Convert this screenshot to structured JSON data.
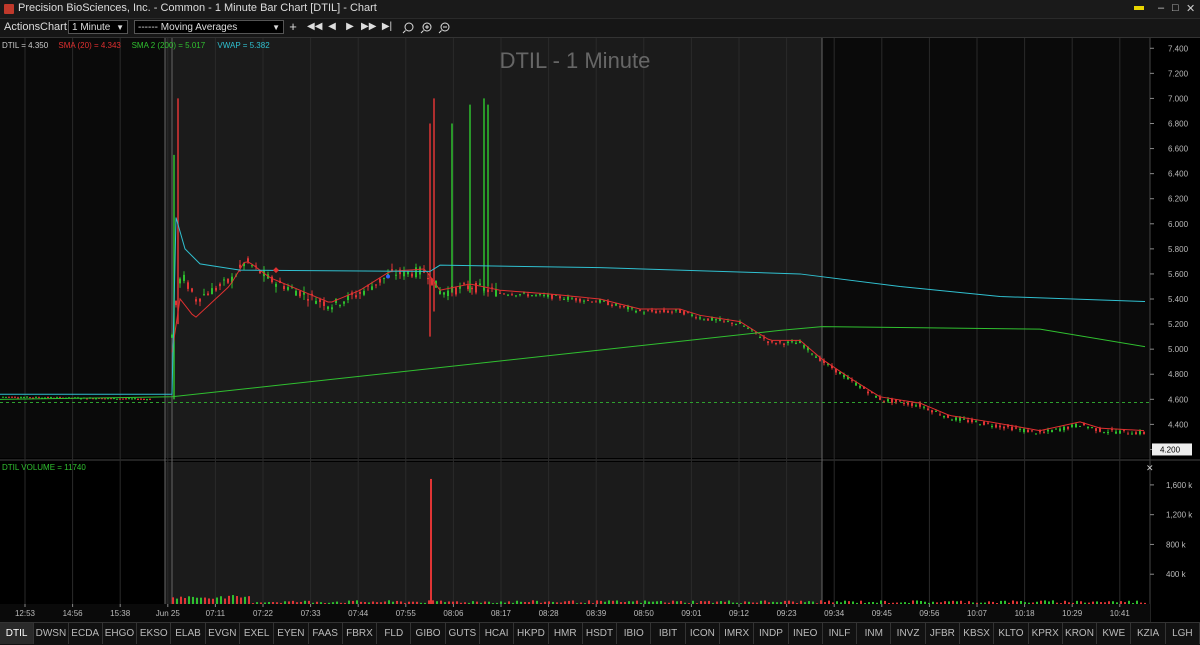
{
  "window": {
    "title": "Precision BioSciences, Inc. - Common - 1 Minute Bar Chart [DTIL] - Chart",
    "min_icon": "minimize-icon",
    "max_icon": "maximize-icon",
    "close_icon": "close-icon"
  },
  "toolbar": {
    "actions": "Actions",
    "chart": "Chart",
    "interval": "1 Minute",
    "studies": "------ Moving Averages",
    "add": "+",
    "nav": [
      "◀◀",
      "◀",
      "▶",
      "▶▶",
      "▶|"
    ],
    "zoom_icons": [
      "magnifier-icon",
      "zoom-in-icon",
      "zoom-out-icon"
    ]
  },
  "chart": {
    "watermark": "DTIL - 1 Minute",
    "legend": [
      {
        "text": "DTIL = 4.350",
        "color": "#cccccc"
      },
      {
        "text": "SMA (20) = 4.343",
        "color": "#e03030"
      },
      {
        "text": "SMA 2 (200) = 5.017",
        "color": "#30c030"
      },
      {
        "text": "VWAP = 5.382",
        "color": "#30c0d0"
      }
    ],
    "last_price": "4.200",
    "y_ticks": [
      "7.400",
      "7.200",
      "7.000",
      "6.800",
      "6.600",
      "6.400",
      "6.200",
      "6.000",
      "5.800",
      "5.600",
      "5.400",
      "5.200",
      "5.000",
      "4.800",
      "4.600",
      "4.400",
      "4.200"
    ],
    "vol_label": "DTIL VOLUME = 11740",
    "vol_ticks": [
      "1,600 k",
      "1,200 k",
      "800 k",
      "400 k"
    ],
    "vol_close": "✕",
    "x_ticks": [
      "12:53",
      "14:56",
      "15:38",
      "Jun 25",
      "07:11",
      "07:22",
      "07:33",
      "07:44",
      "07:55",
      "08:06",
      "08:17",
      "08:28",
      "08:39",
      "08:50",
      "09:01",
      "09:12",
      "09:23",
      "09:34",
      "09:45",
      "09:56",
      "10:07",
      "10:18",
      "10:29",
      "10:41"
    ]
  },
  "tabs": [
    "DTIL",
    "DWSN",
    "ECDA",
    "EHGO",
    "EKSO",
    "ELAB",
    "EVGN",
    "EXEL",
    "EYEN",
    "FAAS",
    "FBRX",
    "FLD",
    "GIBO",
    "GUTS",
    "HCAI",
    "HKPD",
    "HMR",
    "HSDT",
    "IBIO",
    "IBIT",
    "ICON",
    "IMRX",
    "INDP",
    "INEO",
    "INLF",
    "INM",
    "INVZ",
    "JFBR",
    "KBSX",
    "KLTO",
    "KPRX",
    "KRON",
    "KWE",
    "KZIA",
    "LGH"
  ],
  "chart_data": {
    "type": "candlestick",
    "title": "DTIL - 1 Minute",
    "ylim": [
      4.1,
      7.45
    ],
    "series": [
      {
        "name": "DTIL",
        "values_desc": "price bars",
        "last": 4.35
      },
      {
        "name": "SMA (20)",
        "last": 4.343
      },
      {
        "name": "SMA 2 (200)",
        "last": 5.017
      },
      {
        "name": "VWAP",
        "last": 5.382
      }
    ],
    "volume_last": 11740
  }
}
